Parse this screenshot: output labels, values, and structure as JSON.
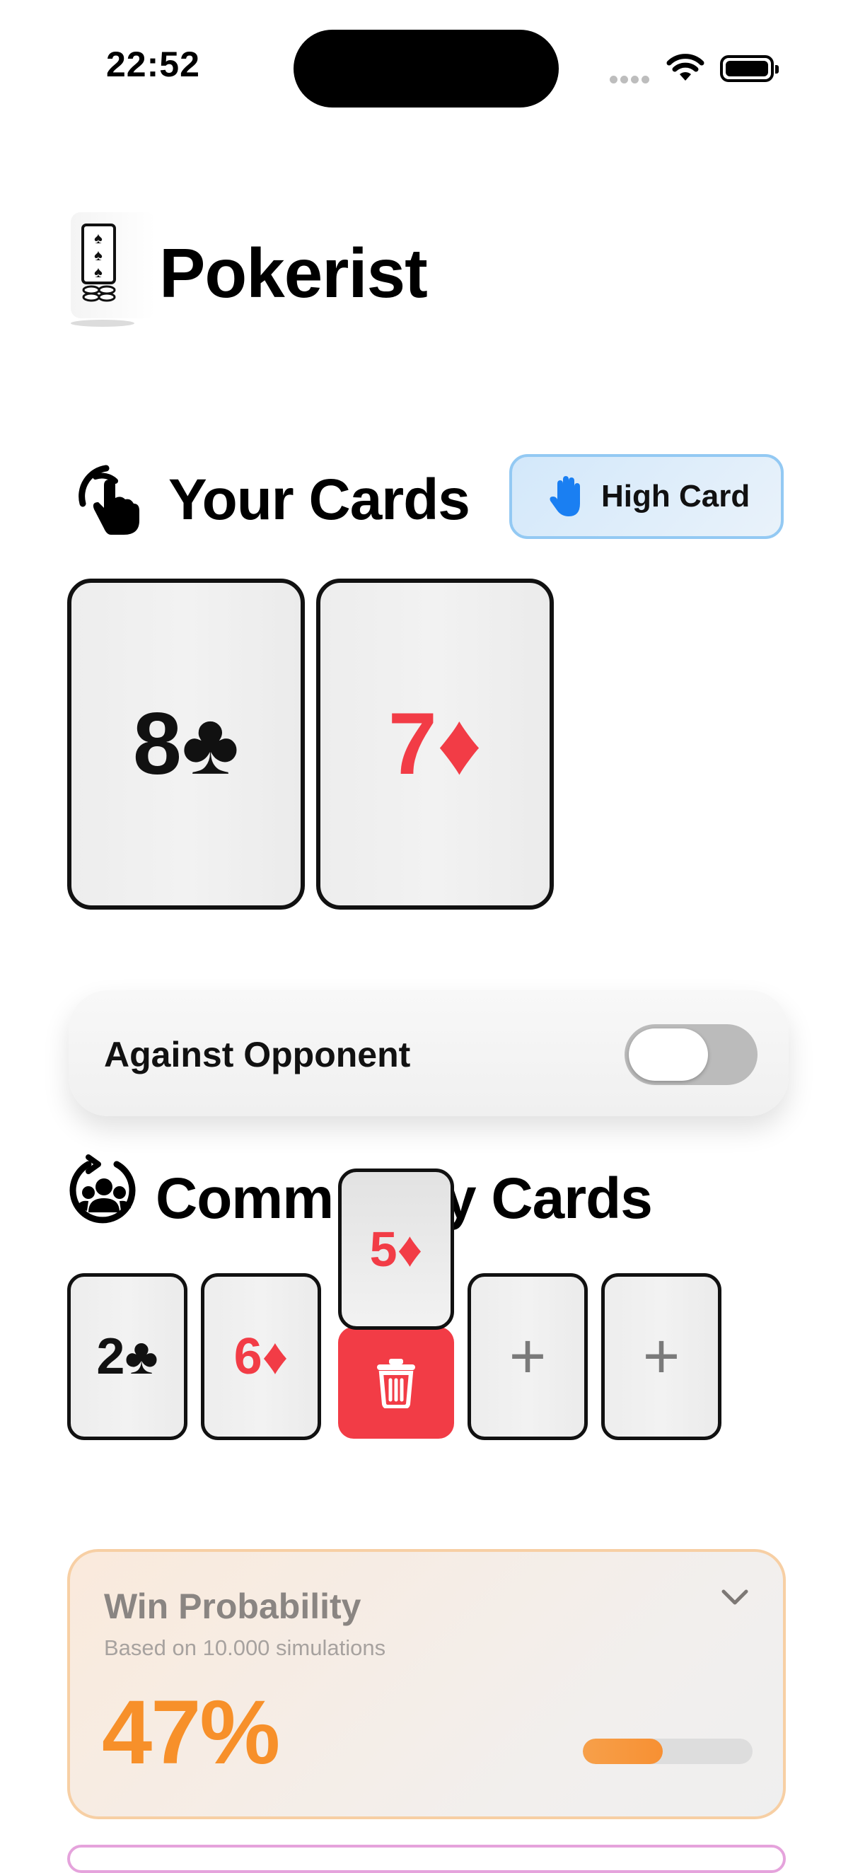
{
  "status_bar": {
    "time": "22:52"
  },
  "app": {
    "title": "Pokerist",
    "logo_icon": "playing-card-chips-icon"
  },
  "your_cards": {
    "title": "Your Cards",
    "icon": "tap-hand-icon",
    "hand_badge": {
      "icon": "raised-hand-icon",
      "label": "High Card",
      "icon_color": "#1a7ff2"
    },
    "cards": [
      {
        "rank": "8",
        "suit": "♣",
        "color": "black"
      },
      {
        "rank": "7",
        "suit": "♦",
        "color": "red"
      }
    ]
  },
  "opponent_toggle": {
    "label": "Against Opponent",
    "enabled": false
  },
  "community_cards": {
    "title_left": "Comm",
    "title_right": "y Cards",
    "icon": "community-group-icon",
    "cards": [
      {
        "rank": "2",
        "suit": "♣",
        "color": "black"
      },
      {
        "rank": "6",
        "suit": "♦",
        "color": "red"
      }
    ],
    "dragging_card": {
      "rank": "5",
      "suit": "♦",
      "color": "red"
    },
    "delete_icon": "trash-icon",
    "add_slots": [
      "+",
      "+"
    ]
  },
  "win_probability": {
    "title": "Win Probability",
    "subtitle": "Based on 10.000 simulations",
    "value": "47%",
    "fraction": 0.47,
    "accent": "#f7902a"
  },
  "colors": {
    "red_suit": "#f23c46",
    "accent_blue": "#93c9f3",
    "accent_orange": "#f7902a"
  }
}
